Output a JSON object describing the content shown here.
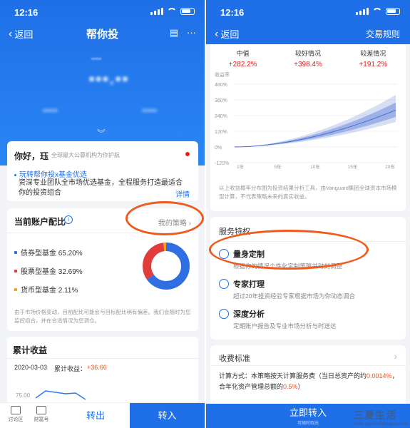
{
  "left": {
    "status": {
      "time": "12:16"
    },
    "nav": {
      "back": "返回",
      "title": "帮你投"
    },
    "hello": {
      "greet": "你好，珏",
      "sub": "全球最大公募机构为你护航",
      "promo": "玩转帮你投x基金优选",
      "desc": "资深专业团队全市场优选基金，全程服务打造最适合你的投资组合",
      "more": "详情"
    },
    "alloc": {
      "title": "当前账户配比",
      "strategy": "我的策略",
      "legend": [
        {
          "label": "债券型基金 65.20%",
          "value": 65.2,
          "color": "#2f6fe2"
        },
        {
          "label": "股票型基金 32.69%",
          "value": 32.69,
          "color": "#e13b3b"
        },
        {
          "label": "货币型基金 2.11%",
          "value": 2.11,
          "color": "#f0a020"
        }
      ],
      "note": "由于市场价格变动，目前配比可能会与目标配比稍有偏差。我们会随时为您监控组合，并在合适情况为您调仓。"
    },
    "returns": {
      "title": "累计收益",
      "date": "2020-03-03",
      "label": "累计收益：",
      "gain": "+36.66",
      "tick": "75.00"
    },
    "bottom": {
      "tab1": "讨论区",
      "tab2": "财富号",
      "sell": "转出",
      "buy": "转入"
    }
  },
  "right": {
    "status": {
      "time": "12:16"
    },
    "nav": {
      "back": "返回",
      "rules": "交易规则"
    },
    "scenarios": [
      {
        "name": "中值",
        "value": "+282.2%"
      },
      {
        "name": "较好情况",
        "value": "+398.4%"
      },
      {
        "name": "较差情况",
        "value": "+191.2%"
      }
    ],
    "chart": {
      "ylabel": "收益率",
      "yticks": [
        "480%",
        "360%",
        "240%",
        "120%",
        "0%",
        "-120%"
      ],
      "xticks": [
        "1年",
        "5年",
        "10年",
        "15年",
        "20年"
      ]
    },
    "foot": "以上收益概率分布图为投资结果分析工具，由Vanguard集团全球资本市场模型计算，不代表策略未来的真实收益。",
    "service": {
      "title": "服务特权",
      "features": [
        {
          "title": "量身定制",
          "text": "根据你的情况个性化定制策略并时刻调整"
        },
        {
          "title": "专家打理",
          "text": "超过20年投资经验专家根据市场为你动态调合"
        },
        {
          "title": "深度分析",
          "text": "定期账户报告及专业市场分析与时送达"
        }
      ]
    },
    "fee": {
      "title": "收费标准",
      "calc_a": "计算方式：本策略按天计算服务费（当日总资产的约",
      "rate1": "0.0014%",
      "calc_b": "，合年化资产管理总额的",
      "rate2": "0.5%",
      "calc_c": "）"
    },
    "button": {
      "main": "立即转入",
      "sub": "可随时取出"
    }
  },
  "watermark": {
    "main": "三夏生活",
    "sub": "www.sanxiashenghuo.com"
  },
  "colors": {
    "primary": "#1e6fe8",
    "up": "#e02020",
    "annotation": "#f05a1c"
  }
}
